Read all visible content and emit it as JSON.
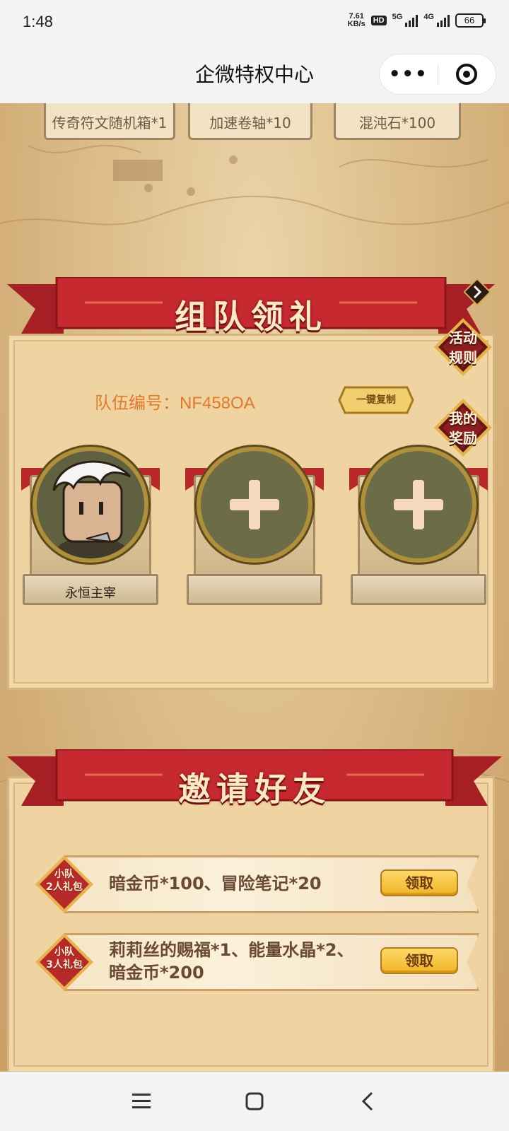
{
  "status_bar": {
    "time": "1:48",
    "net_speed_value": "7.61",
    "net_speed_unit": "KB/s",
    "hd_badge": "HD",
    "signal_5g": "5G",
    "signal_4g": "4G",
    "battery": "66"
  },
  "header": {
    "title": "企微特权中心",
    "more_icon": "more-dots-icon",
    "close_icon": "target-close-icon"
  },
  "top_rewards": [
    {
      "label": "传奇符文随机箱*1"
    },
    {
      "label": "加速卷轴*10"
    },
    {
      "label": "混沌石*100"
    }
  ],
  "team_section": {
    "title": "组队领礼",
    "side_buttons": {
      "rules_line1": "活动",
      "rules_line2": "规则",
      "rewards_line1": "我的",
      "rewards_line2": "奖励"
    },
    "team_id_text": "队伍编号：NF458OA",
    "copy_button": "一键复制",
    "members": [
      {
        "name": "永恒主宰",
        "filled": true
      },
      {
        "name": "",
        "filled": false
      },
      {
        "name": "",
        "filled": false
      }
    ]
  },
  "invite_section": {
    "title": "邀请好友",
    "packs": [
      {
        "badge_line1": "小队",
        "badge_line2": "2人礼包",
        "reward_line1": "暗金币*100、冒险笔记*20",
        "reward_line2": "",
        "button": "领取"
      },
      {
        "badge_line1": "小队",
        "badge_line2": "3人礼包",
        "reward_line1": "莉莉丝的赐福*1、能量水晶*2、",
        "reward_line2": "暗金币*200",
        "button": "领取"
      }
    ]
  },
  "nav": {
    "menu_icon": "menu-icon",
    "home_icon": "home-square-icon",
    "back_icon": "back-chevron-icon"
  },
  "colors": {
    "ribbon_red": "#c62a30",
    "panel": "#efd3a0",
    "team_id_orange": "#e07a2c",
    "claim_button": "#f7c53a"
  }
}
